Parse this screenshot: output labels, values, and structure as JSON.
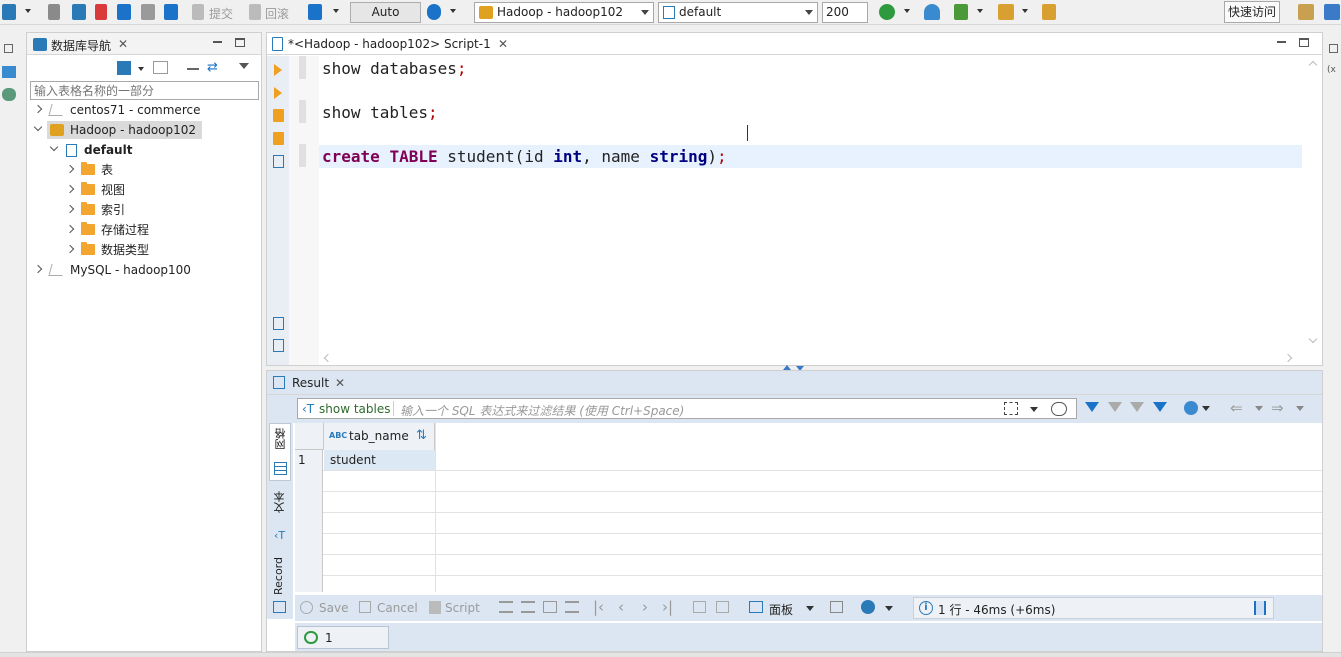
{
  "toolbar": {
    "commit_label": "提交",
    "rollback_label": "回滚",
    "auto_label": "Auto",
    "connection_value": "Hadoop - hadoop102",
    "database_value": "default",
    "limit_value": "200",
    "quick_access_label": "快速访问",
    "icons": [
      "connect-icon",
      "disconnect-icon",
      "invalidate-icon",
      "transaction-icon",
      "history-icon",
      "run-icon",
      "debug-icon"
    ]
  },
  "navigator": {
    "title": "数据库导航",
    "filter_placeholder": "输入表格名称的一部分",
    "tree": [
      {
        "label": "centos71 - commerce",
        "level": 0,
        "expanded": false
      },
      {
        "label": "Hadoop - hadoop102",
        "level": 0,
        "expanded": true,
        "selected": true
      },
      {
        "label": "default",
        "level": 1,
        "expanded": true,
        "bold": true
      },
      {
        "label": "表",
        "level": 2,
        "expanded": false
      },
      {
        "label": "视图",
        "level": 2,
        "expanded": false
      },
      {
        "label": "索引",
        "level": 2,
        "expanded": false
      },
      {
        "label": "存储过程",
        "level": 2,
        "expanded": false
      },
      {
        "label": "数据类型",
        "level": 2,
        "expanded": false
      },
      {
        "label": "MySQL - hadoop100",
        "level": 0,
        "expanded": false
      }
    ]
  },
  "editor": {
    "tab_title": "*<Hadoop - hadoop102> Script-1",
    "lines": {
      "l1_a": "show databases",
      "l1_semi": ";",
      "l2_a": "show tables",
      "l2_semi": ";",
      "l3_kw1": "create",
      "l3_kw2": "TABLE",
      "l3_a": "student(id ",
      "l3_type1": "int",
      "l3_b": ", name ",
      "l3_type2": "string",
      "l3_c": ")",
      "l3_semi": ";"
    }
  },
  "result": {
    "tab_title": "Result",
    "query_label": "show tables",
    "filter_placeholder": "输入一个 SQL 表达式来过滤结果 (使用 Ctrl+Space)",
    "side_tabs": [
      "网格",
      "文本",
      "Record"
    ],
    "columns": [
      "tab_name"
    ],
    "rows": [
      {
        "num": "1",
        "values": [
          "student"
        ]
      }
    ],
    "actions": {
      "save": "Save",
      "cancel": "Cancel",
      "script": "Script",
      "panels": "面板"
    },
    "status_text": "1 行 - 46ms (+6ms)",
    "refresh_count": "1"
  },
  "colors": {
    "keyword": "#7f0055",
    "type_keyword": "#000080",
    "semicolon": "#b00000",
    "panel_blue": "#dce6f2",
    "current_line": "#e8f2fe"
  }
}
